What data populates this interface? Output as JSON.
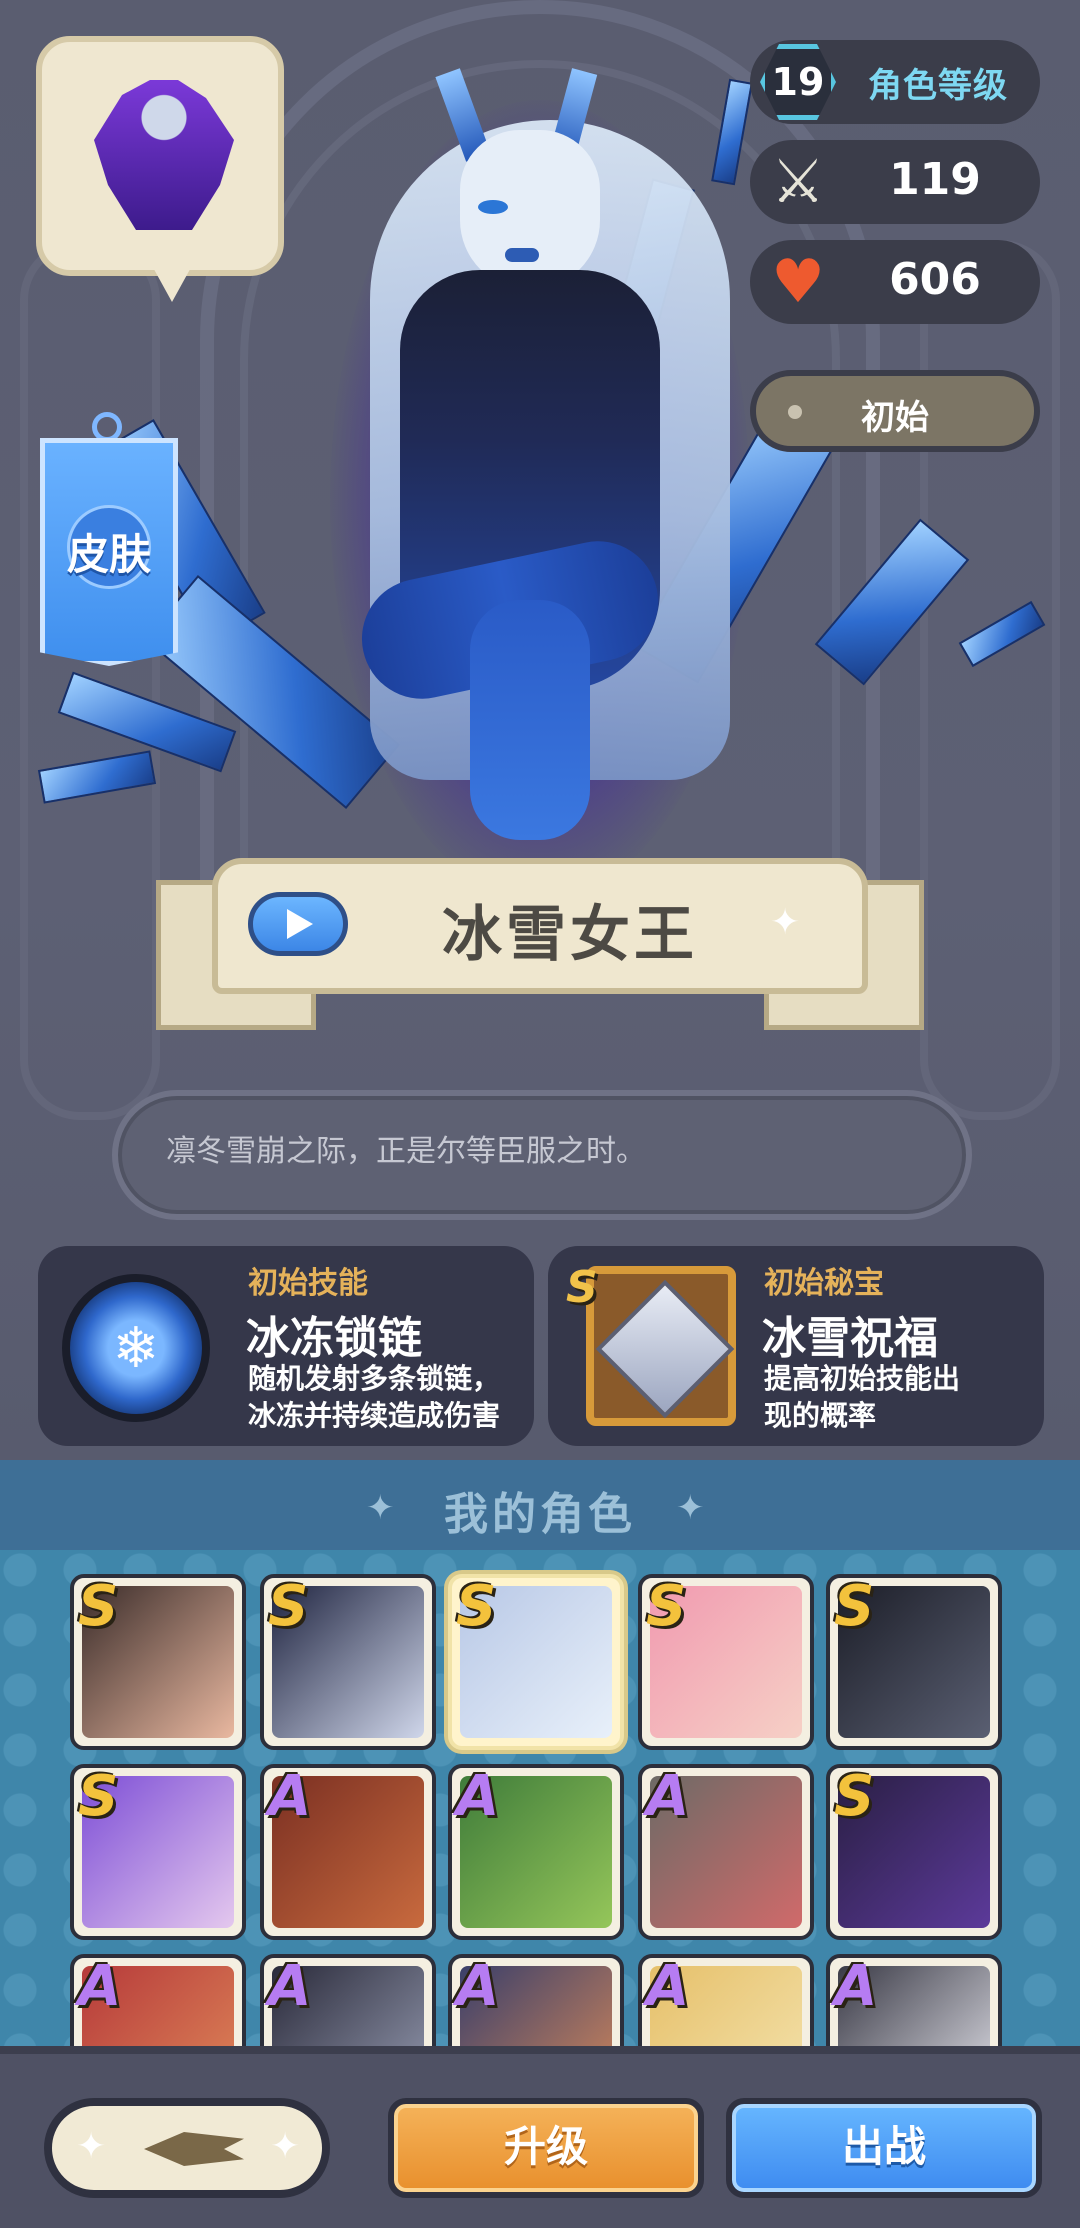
{
  "character": {
    "level": "19",
    "level_label": "角色等级",
    "attack": "119",
    "hp": "606",
    "skin_state": "初始",
    "skin_button": "皮肤",
    "name": "冰雪女王",
    "quote": "凛冬雪崩之际，正是尔等臣服之时。"
  },
  "skill": {
    "label": "初始技能",
    "name": "冰冻锁链",
    "desc_line1": "随机发射多条锁链，",
    "desc_line2": "冰冻并持续造成伤害"
  },
  "treasure": {
    "rank": "S",
    "label": "初始秘宝",
    "name": "冰雪祝福",
    "desc_line1": "提高初始技能出",
    "desc_line2": "现的概率"
  },
  "roster": {
    "title": "我的角色",
    "ranks": [
      "S",
      "S",
      "S",
      "S",
      "S",
      "S",
      "A",
      "A",
      "A",
      "S",
      "A",
      "A",
      "A",
      "A",
      "A"
    ],
    "selected_index": 2
  },
  "buttons": {
    "upgrade": "升级",
    "deploy": "出战"
  },
  "colors": {
    "rank_s": "#f3c23c",
    "rank_a": "#b67cf2",
    "upgrade": "#e88f2c",
    "deploy": "#3d8af0"
  }
}
